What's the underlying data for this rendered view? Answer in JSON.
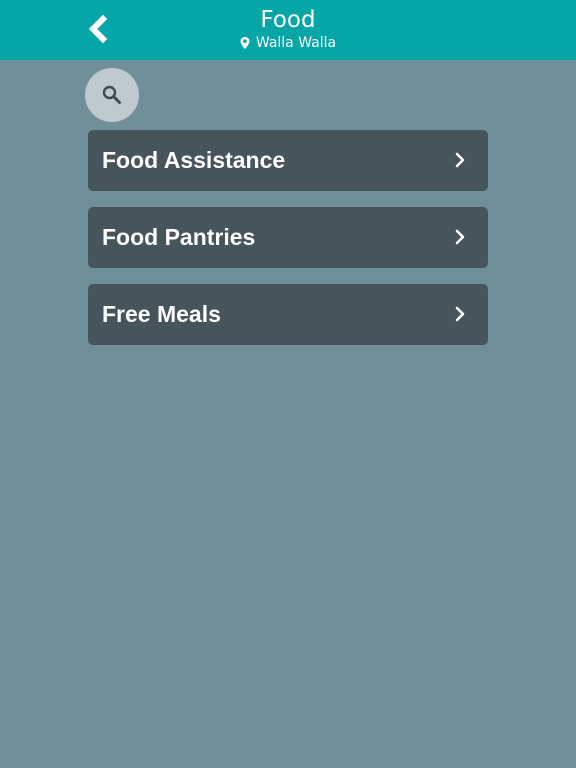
{
  "header": {
    "title": "Food",
    "location": "Walla Walla",
    "back_icon": "chevron-left-icon",
    "location_icon": "map-pin-icon",
    "background": "#06a6a6"
  },
  "search": {
    "icon": "search-icon"
  },
  "menu": {
    "items": [
      {
        "label": "Food Assistance",
        "icon": "chevron-right-icon"
      },
      {
        "label": "Food Pantries",
        "icon": "chevron-right-icon"
      },
      {
        "label": "Free Meals",
        "icon": "chevron-right-icon"
      }
    ]
  },
  "colors": {
    "background": "#718f99",
    "item_background": "#46545b",
    "accent": "#06a6a6"
  }
}
